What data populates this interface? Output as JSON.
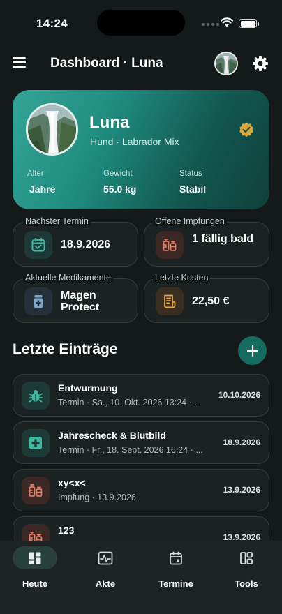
{
  "status_bar": {
    "time": "14:24"
  },
  "header": {
    "title": "Dashboard · Luna"
  },
  "pet": {
    "name": "Luna",
    "breed": "Hund · Labrador Mix",
    "stats": [
      {
        "label": "Alter",
        "value": "Jahre"
      },
      {
        "label": "Gewicht",
        "value": "55.0 kg"
      },
      {
        "label": "Status",
        "value": "Stabil"
      }
    ]
  },
  "tiles": [
    {
      "label": "Nächster Termin",
      "value": "18.9.2026",
      "icon": "calendar-check-icon"
    },
    {
      "label": "Offene Impfungen",
      "value": "1 fällig bald",
      "icon": "vaccine-icon"
    },
    {
      "label": "Aktuelle Medikamente",
      "value": "Magen Protect",
      "icon": "medicine-bottle-icon"
    },
    {
      "label": "Letzte Kosten",
      "value": "22,50 €",
      "icon": "receipt-icon"
    }
  ],
  "entries_section": {
    "title": "Letzte Einträge"
  },
  "entries": [
    {
      "title": "Entwurmung",
      "subtitle": "Termin · Sa., 10. Okt. 2026 13:24 · ...",
      "date": "10.10.2026",
      "icon": "bug-icon"
    },
    {
      "title": "Jahrescheck & Blutbild",
      "subtitle": "Termin · Fr., 18. Sept. 2026 16:24 · ...",
      "date": "18.9.2026",
      "icon": "medical-cross-icon"
    },
    {
      "title": "xy<x<",
      "subtitle": "Impfung · 13.9.2026",
      "date": "13.9.2026",
      "icon": "vaccine-icon"
    },
    {
      "title": "123",
      "subtitle": "",
      "date": "13.9.2026",
      "icon": "vaccine-icon"
    }
  ],
  "tab_bar": {
    "tabs": [
      {
        "label": "Heute",
        "icon": "dashboard-icon",
        "active": true
      },
      {
        "label": "Akte",
        "icon": "health-record-icon"
      },
      {
        "label": "Termine",
        "icon": "calendar-icon"
      },
      {
        "label": "Tools",
        "icon": "tools-icon"
      }
    ]
  },
  "colors": {
    "accent": "#166b5f",
    "verified": "#e0a83a",
    "vaccine": "#e27a62",
    "receipt": "#e8a649",
    "medicine": "#7ea6c9"
  }
}
